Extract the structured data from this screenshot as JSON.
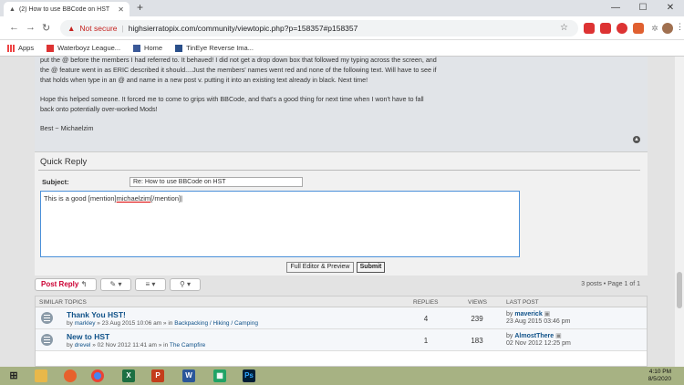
{
  "browser": {
    "tab_title": "(2) How to use BBCode on HST",
    "tab_close": "✕",
    "new_tab": "+",
    "address": {
      "not_secure": "Not secure",
      "separator": "|",
      "url": "highsierratopix.com/community/viewtopic.php?p=158357#p158357"
    },
    "window_controls": [
      "—",
      "☐",
      "✕"
    ],
    "bookmarks": [
      "Apps",
      "Waterboyz League...",
      "Home",
      "TinEye Reverse Ima..."
    ]
  },
  "post": {
    "lines": [
      "put the @ before the members I had referred to. It behaved! I did not get a drop down box that followed my typing across the screen, and",
      "the @ feature went in as ERIC described it should....Just the members' names went red and none of the following text. Will have to see if",
      "that holds when type in an @ and name in a new post v. putting it into an existing text already in black. Next time!",
      "Hope this helped someone. It forced me to come to grips with BBCode, and that's a good thing for next time when I won't have to fall",
      "back onto potentially over-worked Mods!",
      "Best ~ Michaelzim"
    ]
  },
  "quick_reply": {
    "heading": "Quick Reply",
    "subject_label": "Subject:",
    "subject_value": "Re: How to use BBCode on HST",
    "editor_text_a": "This is a good [mention]",
    "editor_text_b": "michaelzim",
    "editor_text_c": "[/mention]",
    "full_editor_label": "Full Editor & Preview",
    "submit_label": "Submit"
  },
  "actions": {
    "post_reply": "Post Reply",
    "page_info": "3 posts • Page 1 of 1"
  },
  "similar": {
    "headers": {
      "topics": "SIMILAR TOPICS",
      "replies": "REPLIES",
      "views": "VIEWS",
      "last_post": "LAST POST"
    },
    "rows": [
      {
        "title": "Thank You HST!",
        "by": "by",
        "user": "markley",
        "date": "» 23 Aug 2015 10:06 am » in",
        "forum": "Backpacking / Hiking / Camping",
        "replies": "4",
        "views": "239",
        "lp_user": "maverick",
        "lp_date": "23 Aug 2015 03:46 pm"
      },
      {
        "title": "New to HST",
        "by": "by",
        "user": "drevel",
        "date": "» 02 Nov 2012 11:41 am » in",
        "forum": "The Campfire",
        "replies": "1",
        "views": "183",
        "lp_user": "AlmostThere",
        "lp_date": "02 Nov 2012 12:25 pm"
      }
    ]
  },
  "taskbar": {
    "time": "4:10 PM",
    "date": "8/5/2020"
  }
}
